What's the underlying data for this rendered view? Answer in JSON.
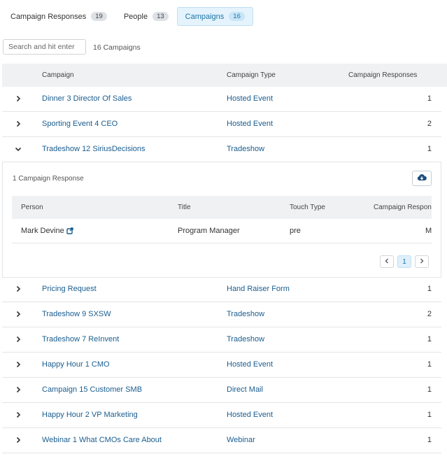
{
  "tabs": [
    {
      "label": "Campaign Responses",
      "count": "19"
    },
    {
      "label": "People",
      "count": "13"
    },
    {
      "label": "Campaigns",
      "count": "16"
    }
  ],
  "search": {
    "placeholder": "Search and hit enter"
  },
  "campaign_count": "16 Campaigns",
  "table": {
    "headers": {
      "campaign": "Campaign",
      "type": "Campaign Type",
      "responses": "Campaign Responses"
    },
    "rows": [
      {
        "name": "Dinner 3 Director Of Sales",
        "type": "Hosted Event",
        "responses": "1"
      },
      {
        "name": "Sporting Event 4 CEO",
        "type": "Hosted Event",
        "responses": "2"
      },
      {
        "name": "Tradeshow 12 SiriusDecisions",
        "type": "Tradeshow",
        "responses": "1"
      },
      {
        "name": "Pricing Request",
        "type": "Hand Raiser Form",
        "responses": "1"
      },
      {
        "name": "Tradeshow 9 SXSW",
        "type": "Tradeshow",
        "responses": "2"
      },
      {
        "name": "Tradeshow 7 ReInvent",
        "type": "Tradeshow",
        "responses": "1"
      },
      {
        "name": "Happy Hour 1 CMO",
        "type": "Hosted Event",
        "responses": "1"
      },
      {
        "name": "Campaign 15 Customer SMB",
        "type": "Direct Mail",
        "responses": "1"
      },
      {
        "name": "Happy Hour 2 VP Marketing",
        "type": "Hosted Event",
        "responses": "1"
      },
      {
        "name": "Webinar 1 What CMOs Care About",
        "type": "Webinar",
        "responses": "1"
      }
    ]
  },
  "expanded": {
    "title": "1 Campaign Response",
    "headers": {
      "person": "Person",
      "title": "Title",
      "touch": "Touch Type",
      "response": "Campaign Respon"
    },
    "rows": [
      {
        "person": "Mark Devine",
        "title": "Program Manager",
        "touch": "pre",
        "response": "M"
      }
    ],
    "page": "1"
  },
  "icons": {
    "collapsed": "chevron-right-icon",
    "expanded": "chevron-down-icon",
    "download": "cloud-download-icon",
    "external": "external-link-icon"
  },
  "colors": {
    "link": "#1a5d8f",
    "active_tab_bg": "#e4f3fc",
    "header_bg": "#f0f1f3"
  }
}
